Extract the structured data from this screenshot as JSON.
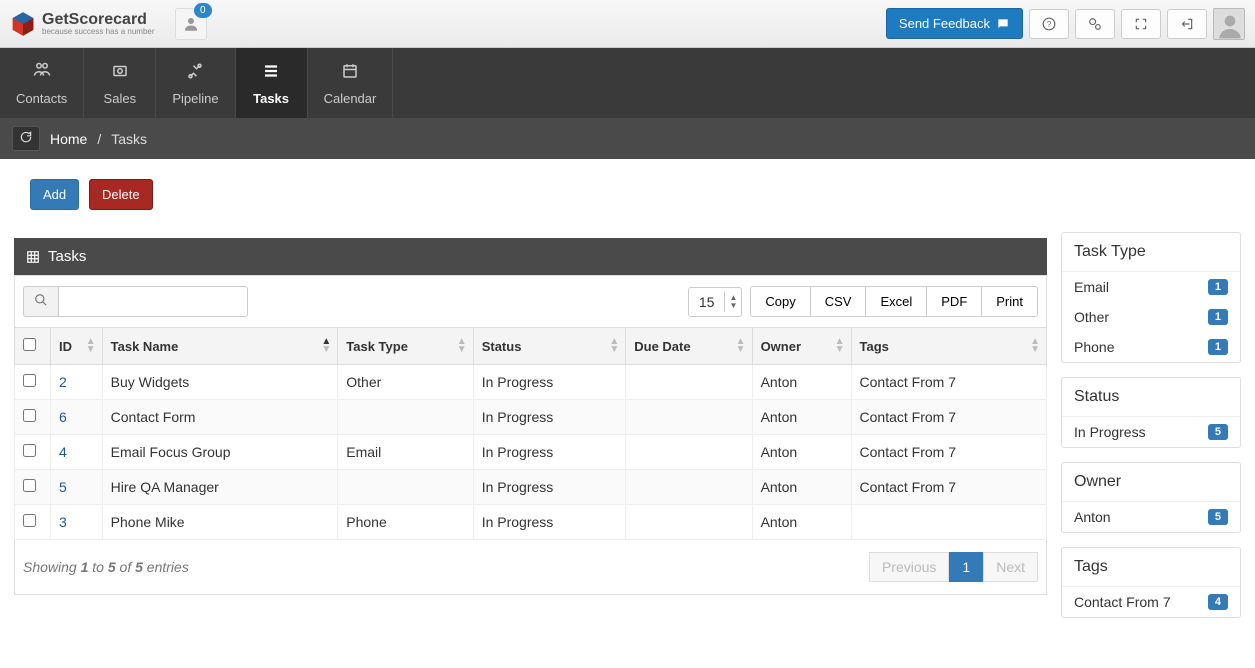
{
  "header": {
    "logo_text": "GetScorecard",
    "logo_sub": "because success has a number",
    "notif_count": "0",
    "feedback_label": "Send Feedback"
  },
  "nav": [
    {
      "label": "Contacts"
    },
    {
      "label": "Sales"
    },
    {
      "label": "Pipeline"
    },
    {
      "label": "Tasks",
      "active": true
    },
    {
      "label": "Calendar"
    }
  ],
  "breadcrumb": {
    "home": "Home",
    "current": "Tasks"
  },
  "actions": {
    "add": "Add",
    "delete": "Delete"
  },
  "panel": {
    "title": "Tasks",
    "page_size": "15",
    "exports": [
      "Copy",
      "CSV",
      "Excel",
      "PDF",
      "Print"
    ]
  },
  "columns": [
    "",
    "ID",
    "Task Name",
    "Task Type",
    "Status",
    "Due Date",
    "Owner",
    "Tags"
  ],
  "rows": [
    {
      "id": "2",
      "name": "Buy Widgets",
      "type": "Other",
      "status": "In Progress",
      "due": "",
      "owner": "Anton",
      "tags": "Contact From 7"
    },
    {
      "id": "6",
      "name": "Contact Form",
      "type": "",
      "status": "In Progress",
      "due": "",
      "owner": "Anton",
      "tags": "Contact From 7"
    },
    {
      "id": "4",
      "name": "Email Focus Group",
      "type": "Email",
      "status": "In Progress",
      "due": "",
      "owner": "Anton",
      "tags": "Contact From 7"
    },
    {
      "id": "5",
      "name": "Hire QA Manager",
      "type": "",
      "status": "In Progress",
      "due": "",
      "owner": "Anton",
      "tags": "Contact From 7"
    },
    {
      "id": "3",
      "name": "Phone Mike",
      "type": "Phone",
      "status": "In Progress",
      "due": "",
      "owner": "Anton",
      "tags": ""
    }
  ],
  "showing": {
    "prefix": "Showing ",
    "from": "1",
    "mid1": " to ",
    "to": "5",
    "mid2": " of ",
    "total": "5",
    "suffix": " entries"
  },
  "pager": {
    "prev": "Previous",
    "page": "1",
    "next": "Next"
  },
  "filters": [
    {
      "title": "Task Type",
      "items": [
        {
          "label": "Email",
          "count": "1"
        },
        {
          "label": "Other",
          "count": "1"
        },
        {
          "label": "Phone",
          "count": "1"
        }
      ]
    },
    {
      "title": "Status",
      "items": [
        {
          "label": "In Progress",
          "count": "5"
        }
      ]
    },
    {
      "title": "Owner",
      "items": [
        {
          "label": "Anton",
          "count": "5"
        }
      ]
    },
    {
      "title": "Tags",
      "items": [
        {
          "label": "Contact From 7",
          "count": "4"
        }
      ]
    }
  ]
}
